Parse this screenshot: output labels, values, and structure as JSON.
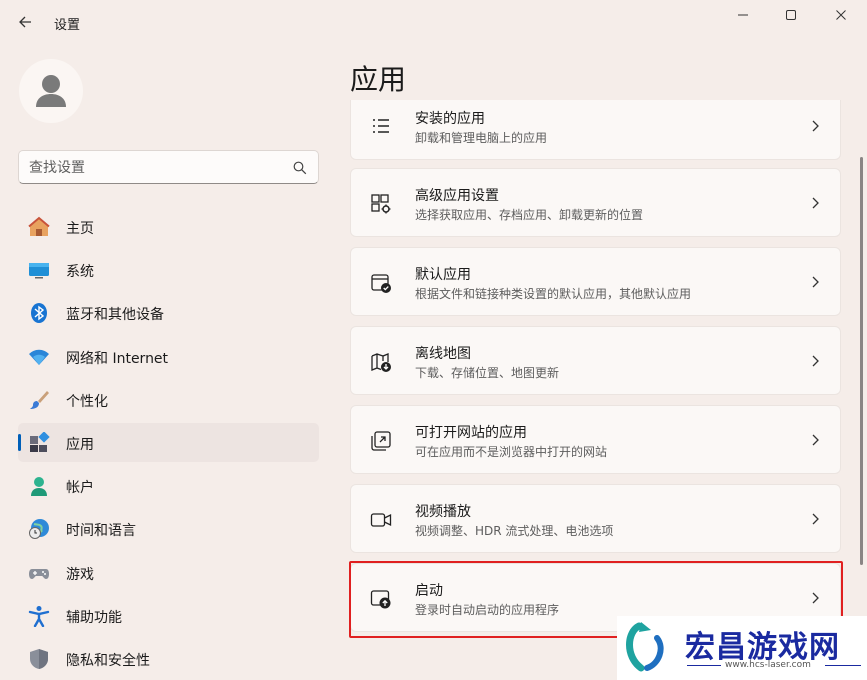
{
  "window": {
    "title": "设置",
    "controls": [
      "minimize-icon",
      "maximize-icon",
      "close-icon"
    ]
  },
  "search": {
    "placeholder": "查找设置"
  },
  "sidebar": {
    "items": [
      {
        "label": "主页",
        "icon": "home-icon"
      },
      {
        "label": "系统",
        "icon": "monitor-icon"
      },
      {
        "label": "蓝牙和其他设备",
        "icon": "bluetooth-icon"
      },
      {
        "label": "网络和 Internet",
        "icon": "wifi-icon"
      },
      {
        "label": "个性化",
        "icon": "paintbrush-icon"
      },
      {
        "label": "应用",
        "icon": "apps-icon",
        "active": true
      },
      {
        "label": "帐户",
        "icon": "account-icon"
      },
      {
        "label": "时间和语言",
        "icon": "globe-clock-icon"
      },
      {
        "label": "游戏",
        "icon": "gamepad-icon"
      },
      {
        "label": "辅助功能",
        "icon": "accessibility-icon"
      },
      {
        "label": "隐私和安全性",
        "icon": "shield-icon"
      }
    ]
  },
  "main": {
    "title": "应用",
    "cards": [
      {
        "title": "安装的应用",
        "subtitle": "卸载和管理电脑上的应用",
        "icon": "list-icon"
      },
      {
        "title": "高级应用设置",
        "subtitle": "选择获取应用、存档应用、卸载更新的位置",
        "icon": "app-settings-icon"
      },
      {
        "title": "默认应用",
        "subtitle": "根据文件和链接种类设置的默认应用，其他默认应用",
        "icon": "default-app-icon"
      },
      {
        "title": "离线地图",
        "subtitle": "下载、存储位置、地图更新",
        "icon": "offline-map-icon"
      },
      {
        "title": "可打开网站的应用",
        "subtitle": "可在应用而不是浏览器中打开的网站",
        "icon": "open-link-icon"
      },
      {
        "title": "视频播放",
        "subtitle": "视频调整、HDR 流式处理、电池选项",
        "icon": "video-icon"
      },
      {
        "title": "启动",
        "subtitle": "登录时自动启动的应用程序",
        "icon": "startup-icon",
        "highlighted": true
      }
    ]
  },
  "watermark": {
    "name": "宏昌游戏网",
    "url": "www.hcs-laser.com"
  },
  "colors": {
    "background": "#f5ede9",
    "accent": "#005fb8",
    "highlight": "#e02020"
  }
}
